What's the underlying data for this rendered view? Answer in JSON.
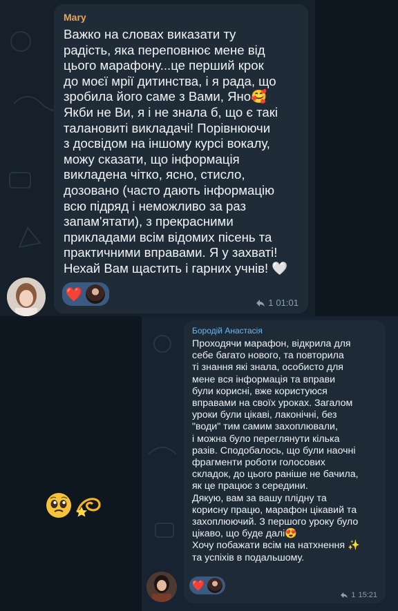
{
  "messages": [
    {
      "author": "Mary",
      "text": "Важко на словах виказати ту\nрадість, яка переповнює мене від\nцього марафону...це перший крок\nдо моєї мрії дитинства, і я рада, що\nзробила його саме з Вами, Яно🥰\nЯкби не Ви, я і не знала б, що є такі\nталановиті викладачі! Порівнюючи\nз досвідом на іншому курсі вокалу,\nможу сказати, що інформація\nвикладена чітко, ясно, стисло,\nдозовано (часто дають  інформацію\nвсю підряд і неможливо за раз\nзапам'ятати), з прекрасними\nприкладами всім відомих пісень та\nпрактичними вправами. Я у захваті!\nНехай Вам щастить і гарних учнів! 🤍",
      "reaction_emoji": "❤️",
      "reply_count": "1",
      "time": "01:01",
      "author_color": "#e7a55b"
    },
    {
      "author": "Бородій Анастасія",
      "text": "Проходячи марафон, відкрила для\nсебе багато нового, та повторила\nті знання які знала, особисто для\nмене вся інформація та вправи\nбули корисні, вже користуюся\nвправами на своїх уроках. Загалом\nуроки були цікаві, лаконічні, без\n\"води\" тим самим захоплювали,\nі можна було переглянути кілька\nразів. Сподобалось, що були наочні\nфрагменти роботи голосових\nскладок, до цього раніше не бачила,\nяк це працює з середини.\nДякую, вам за вашу плідну та\nкорисну  працю, марафон цікавий та\nзахоплюючий. З першого уроку було\nцікаво, що буде далі😍\nХочу побажати всім на натхнення ✨\nта успіхів в подальшому.",
      "reaction_emoji": "❤️",
      "reply_count": "1",
      "time": "15:21",
      "author_color": "#6bb8f0"
    }
  ],
  "standalone_emoji": [
    "🥹",
    "💫"
  ],
  "icons": {
    "reply": "reply-arrow-icon",
    "reaction_avatar": "reactor-avatar",
    "author_avatar": "author-avatar"
  },
  "colors": {
    "bubble": "#1f2c38",
    "reaction_pill": "#3a5a82",
    "meta": "#8aa0b3"
  }
}
